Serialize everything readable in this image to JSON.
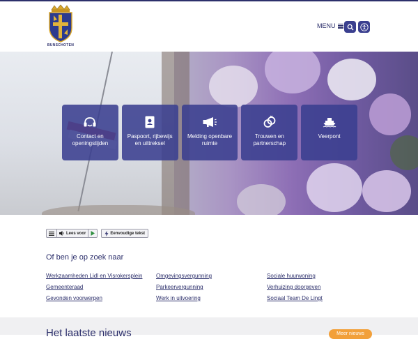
{
  "header": {
    "logo_text": "BUNSCHOTEN",
    "menu_label": "MENU",
    "search_icon": "search-icon",
    "accessibility_icon": "accessibility-icon"
  },
  "colors": {
    "primary": "#2c2f6b",
    "tile": "#3a3f8f",
    "accent": "#f2a03a"
  },
  "tiles": [
    {
      "label": "Contact en openingstijden",
      "icon": "headset-icon"
    },
    {
      "label": "Paspoort, rijbewijs en uittreksel",
      "icon": "passport-icon"
    },
    {
      "label": "Melding openbare ruimte",
      "icon": "megaphone-icon"
    },
    {
      "label": "Trouwen en partnerschap",
      "icon": "rings-icon"
    },
    {
      "label": "Veerpont",
      "icon": "ferry-icon"
    }
  ],
  "readspeaker": {
    "listen_label": "Lees voor",
    "simple_text_label": "Eenvoudige tekst"
  },
  "search_section": {
    "heading": "Of ben je op zoek naar",
    "links": [
      "Werkzaamheden Lidl en Visrokersplein",
      "Omgevingsvergunning",
      "Sociale huurwoning",
      "Gemeenteraad",
      "Parkeervergunning",
      "Verhuizing doorgeven",
      "Gevonden voorwerpen",
      "Werk in uitvoering",
      "Sociaal Team De Lingt"
    ]
  },
  "news": {
    "title": "Het laatste nieuws",
    "more_label": "Meer nieuws"
  }
}
